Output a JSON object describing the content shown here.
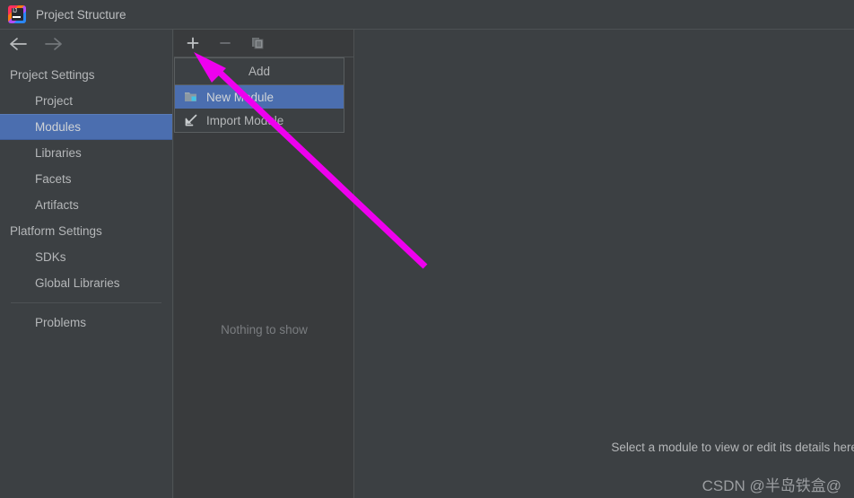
{
  "window": {
    "title": "Project Structure",
    "app_icon": "intellij-idea-logo",
    "logo_text": "IJ"
  },
  "navigation": {
    "back_icon": "arrow-left-icon",
    "forward_icon": "arrow-right-icon"
  },
  "sidebar": {
    "groups": [
      {
        "label": "Project Settings",
        "items": [
          {
            "label": "Project",
            "selected": false
          },
          {
            "label": "Modules",
            "selected": true
          },
          {
            "label": "Libraries",
            "selected": false
          },
          {
            "label": "Facets",
            "selected": false
          },
          {
            "label": "Artifacts",
            "selected": false
          }
        ]
      },
      {
        "label": "Platform Settings",
        "items": [
          {
            "label": "SDKs",
            "selected": false
          },
          {
            "label": "Global Libraries",
            "selected": false
          }
        ]
      }
    ],
    "footer_items": [
      {
        "label": "Problems",
        "selected": false
      }
    ]
  },
  "middle_panel": {
    "toolbar": [
      {
        "name": "add-button",
        "icon": "plus-icon",
        "enabled": true
      },
      {
        "name": "remove-button",
        "icon": "minus-icon",
        "enabled": false
      },
      {
        "name": "copy-button",
        "icon": "copy-icon",
        "enabled": false
      }
    ],
    "empty_text": "Nothing to show"
  },
  "popup_menu": {
    "header": "Add",
    "items": [
      {
        "label": "New Module",
        "icon": "folder-icon",
        "selected": true
      },
      {
        "label": "Import Module",
        "icon": "import-arrow-icon",
        "selected": false
      }
    ]
  },
  "right_panel": {
    "hint": "Select a module to view or edit its details here",
    "watermark": "CSDN @半岛铁盒@"
  },
  "colors": {
    "titlebar_bg": "#3c4043",
    "sidebar_bg": "#3c4043",
    "panel_bg": "#393b3d",
    "selection_blue": "#4b6eaf",
    "text": "#b5b7b9",
    "muted_text": "#7a7d80",
    "border": "#4e5254",
    "annotation_magenta": "#ee00ee"
  }
}
